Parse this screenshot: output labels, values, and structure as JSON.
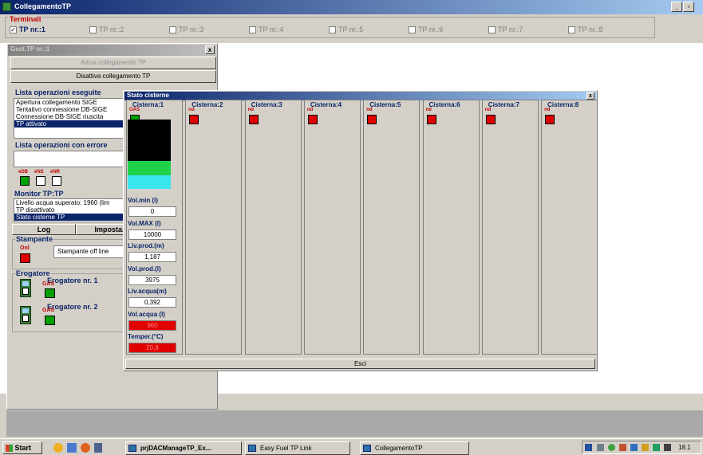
{
  "window": {
    "title": "CollegamentoTP",
    "controls": "_|8|"
  },
  "terminals": {
    "title": "Terminali",
    "items": [
      {
        "label": "TP nr.:1",
        "checked": true
      },
      {
        "label": "TP nr.:2",
        "checked": false
      },
      {
        "label": "TP nr.:3",
        "checked": false
      },
      {
        "label": "TP nr.:4",
        "checked": false
      },
      {
        "label": "TP nr.:5",
        "checked": false
      },
      {
        "label": "TP nr.:6",
        "checked": false
      },
      {
        "label": "TP nr.:7",
        "checked": false
      },
      {
        "label": "TP nr.:8",
        "checked": false
      }
    ]
  },
  "gest": {
    "title": "Gest.TP nr.:1",
    "close": "x",
    "activate_label": "Attiva collegamento TP",
    "deactivate_label": "Disattiva collegamento TP",
    "ops_title": "Lista operazioni eseguite",
    "ops": [
      "Apertura collegamento SIGE",
      "Tentativo connessione DB-SIGE",
      "Connessione DB-SIGE riuscita",
      "TP attivato"
    ],
    "errors_title": "Lista operazioni con errore",
    "flags": [
      "eDB",
      "eNS",
      "eNR"
    ],
    "monitor_title": "Monitor TP:TP",
    "monitor_items": [
      "Livello acqua superato: 1960 (lim",
      "TP disattivato",
      "Stato cisterne TP"
    ],
    "log_label": "Log",
    "settings_label": "Impostazi",
    "printer_title": "Stampante",
    "printer_flag": "Onl",
    "printer_status": "Stampante off line",
    "dispenser_title": "Erogatore",
    "dispenser_1": "Erogatore nr. 1",
    "dispenser_2": "Erogatore nr. 2",
    "gas": "GAS"
  },
  "stato": {
    "title": "Stato cisterne",
    "close": "x",
    "tanks": [
      {
        "label": "Cisterna:1",
        "sub": "GAS",
        "status": "ok"
      },
      {
        "label": "Cisterna:2",
        "sub": "nd",
        "status": "err"
      },
      {
        "label": "Cisterna:3",
        "sub": "nd",
        "status": "err"
      },
      {
        "label": "Cisterna:4",
        "sub": "nd",
        "status": "err"
      },
      {
        "label": "Cisterna:5",
        "sub": "nd",
        "status": "err"
      },
      {
        "label": "Cisterna:6",
        "sub": "nd",
        "status": "err"
      },
      {
        "label": "Cisterna:7",
        "sub": "nd",
        "status": "err"
      },
      {
        "label": "Cisterna:8",
        "sub": "nd",
        "status": "err"
      }
    ],
    "fields": [
      {
        "label": "Vol.min (l)",
        "value": "0",
        "alert": false
      },
      {
        "label": "Vol.MAX (l)",
        "value": "10000",
        "alert": false
      },
      {
        "label": "Liv.prod.(m)",
        "value": "1,187",
        "alert": false
      },
      {
        "label": "Vol.prod.(l)",
        "value": "3975",
        "alert": false
      },
      {
        "label": "Liv.acqua(m)",
        "value": "0,392",
        "alert": false
      },
      {
        "label": "Vol.acqua (l)",
        "value": "960",
        "alert": true
      },
      {
        "label": "Temper.(°C)",
        "value": "20,8",
        "alert": true
      }
    ],
    "exit_label": "Esci"
  },
  "taskbar": {
    "start": "Start",
    "tasks": [
      "prjDACManageTP_Ex...",
      "Easy Fuel TP Link",
      "CollegamentoTP"
    ],
    "clock": "18.1"
  },
  "colors": {
    "title_blue": "#0a246a",
    "ok_green": "#00a000",
    "alert_red": "#e00000",
    "tank_green": "#1fd24a",
    "tank_cyan": "#39e6ee"
  }
}
